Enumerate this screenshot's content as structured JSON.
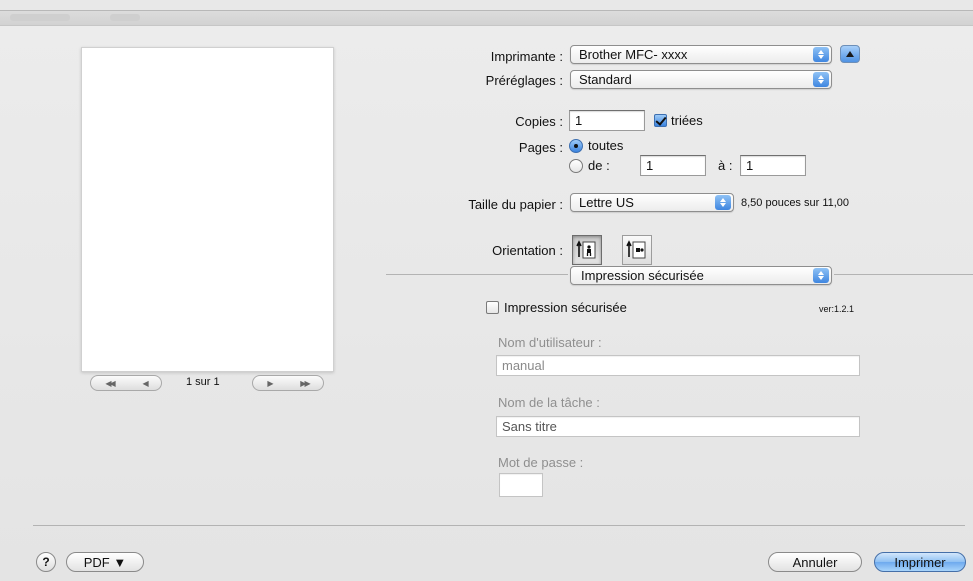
{
  "printer": {
    "label": "Imprimante :",
    "value": "Brother MFC- xxxx"
  },
  "presets": {
    "label": "Préréglages :",
    "value": "Standard"
  },
  "copies": {
    "label": "Copies :",
    "value": "1",
    "collate_label": "triées",
    "collate_checked": true
  },
  "pages": {
    "label": "Pages :",
    "all_label": "toutes",
    "range_label": "de :",
    "from_value": "1",
    "to_label": "à :",
    "to_value": "1",
    "selected": "all"
  },
  "paper_size": {
    "label": "Taille du papier :",
    "value": "Lettre US",
    "dimensions": "8,50 pouces sur 11,00"
  },
  "orientation": {
    "label": "Orientation :",
    "selected": "portrait"
  },
  "panel_menu": {
    "value": "Impression sécurisée"
  },
  "secure": {
    "checkbox_label": "Impression sécurisée",
    "checked": false,
    "version": "ver:1.2.1",
    "username_label": "Nom d'utilisateur :",
    "username_value": "manual",
    "jobname_label": "Nom de la tâche :",
    "jobname_value": "Sans titre",
    "password_label": "Mot de passe :",
    "password_value": ""
  },
  "preview": {
    "page_indicator": "1 sur 1"
  },
  "footer": {
    "help": "?",
    "pdf_label": "PDF ▼",
    "cancel_label": "Annuler",
    "print_label": "Imprimer"
  }
}
